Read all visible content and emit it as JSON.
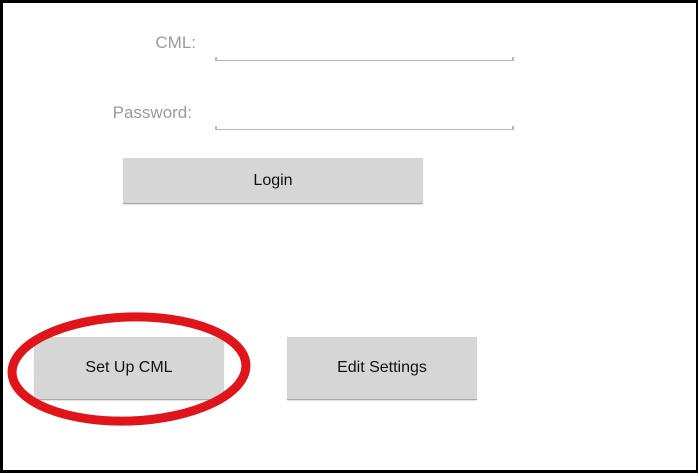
{
  "form": {
    "cml_label": "CML:",
    "cml_value": "",
    "password_label": "Password:",
    "password_value": "",
    "login_label": "Login"
  },
  "actions": {
    "setup_label": "Set Up CML",
    "edit_settings_label": "Edit Settings"
  },
  "annotation": {
    "circle_color": "#e0141b",
    "target": "Set Up CML"
  }
}
